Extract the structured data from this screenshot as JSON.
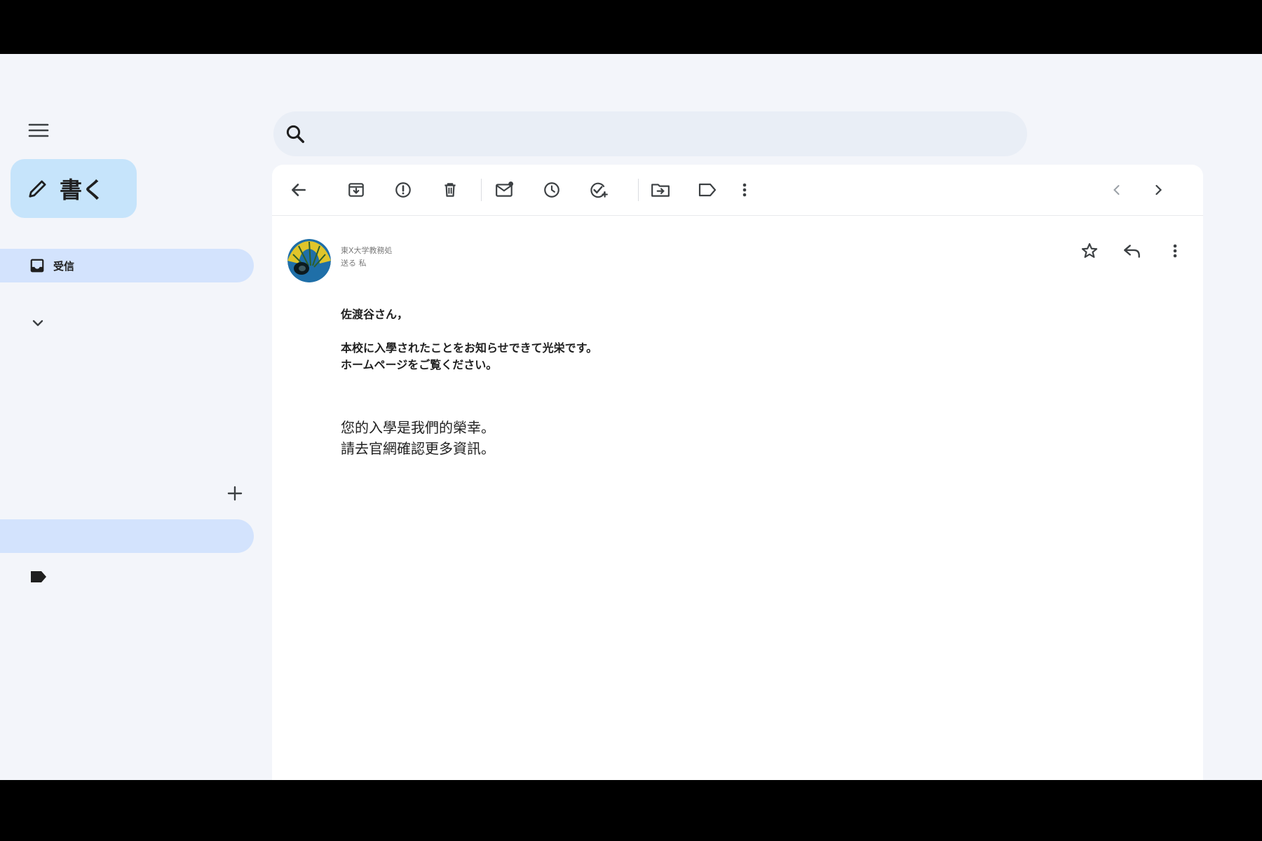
{
  "compose": {
    "label": "書く"
  },
  "nav": {
    "inbox_label": "受信"
  },
  "search": {
    "placeholder": "",
    "value": ""
  },
  "email": {
    "sender": "東X大学教務処",
    "recipient": "送る 私",
    "body_jp": [
      "佐渡谷さん，",
      "本校に入學されたことをお知らせできて光栄です。",
      "ホームページをご覧ください。"
    ],
    "body_zh": [
      "您的入學是我們的榮幸。",
      "請去官網確認更多資訊。"
    ]
  },
  "colors": {
    "compose_bg": "#c6e4fb",
    "nav_active_bg": "#d3e3fd",
    "search_bg": "#e9eef6",
    "app_bg": "#f3f5fa"
  },
  "icons": {
    "toolbar": [
      "back-arrow-icon",
      "archive-icon",
      "report-spam-icon",
      "delete-icon",
      "mark-unread-icon",
      "snooze-icon",
      "add-task-icon",
      "move-to-icon",
      "label-icon",
      "more-vert-icon"
    ],
    "pager": [
      "chevron-left-icon",
      "chevron-right-icon"
    ],
    "header": [
      "star-icon",
      "reply-icon",
      "more-vert-icon"
    ]
  }
}
